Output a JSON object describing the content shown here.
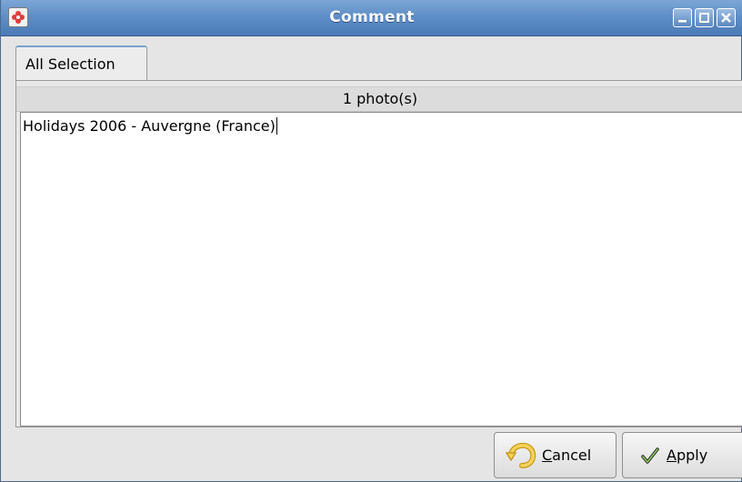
{
  "window": {
    "title": "Comment",
    "accent_color": "#5f8fc7",
    "app_icon": "flower-app-icon",
    "controls": {
      "minimize": "minimize-icon",
      "maximize": "maximize-icon",
      "close": "close-icon"
    }
  },
  "tabs": [
    {
      "label": "All Selection",
      "selected": true
    }
  ],
  "panel": {
    "photo_count_label": "1 photo(s)",
    "comment_text": "Holidays 2006 - Auvergne (France)"
  },
  "buttons": {
    "cancel": {
      "mnemonic": "C",
      "rest": "ancel",
      "icon": "undo-arrow-icon"
    },
    "apply": {
      "mnemonic": "A",
      "rest": "pply",
      "icon": "checkmark-icon"
    }
  }
}
